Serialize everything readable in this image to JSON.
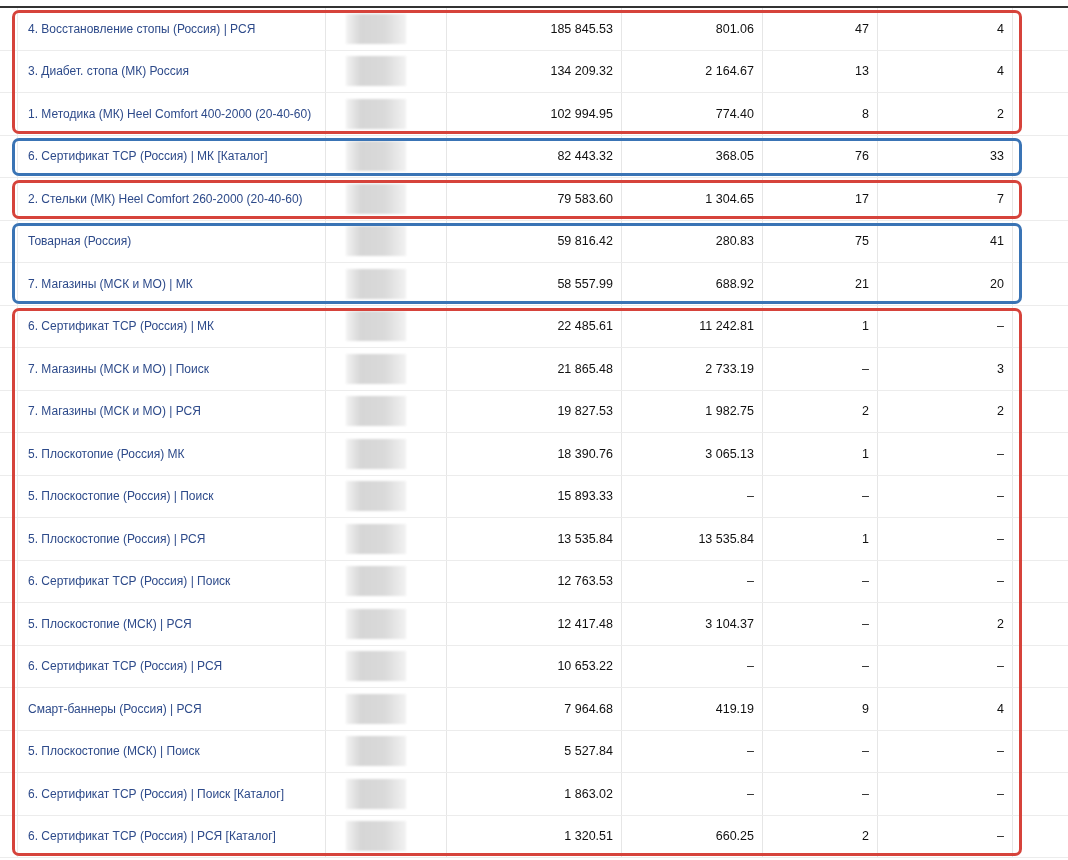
{
  "table": {
    "groups": [
      {
        "color": "#d6433b",
        "rows": [
          {
            "name": "4. Восстановление стопы (Россия) | РСЯ",
            "values": [
              "185 845.53",
              "801.06",
              "47",
              "4"
            ]
          },
          {
            "name": "3. Диабет. стопа (МК) Россия",
            "values": [
              "134 209.32",
              "2 164.67",
              "13",
              "4"
            ]
          },
          {
            "name": "1. Методика (МК) Heel Comfort 400-2000 (20-40-60)",
            "values": [
              "102 994.95",
              "774.40",
              "8",
              "2"
            ]
          }
        ]
      },
      {
        "color": "#3a74b5",
        "rows": [
          {
            "name": "6. Сертификат ТСР (Россия) | МК [Каталог]",
            "values": [
              "82 443.32",
              "368.05",
              "76",
              "33"
            ]
          }
        ]
      },
      {
        "color": "#d6433b",
        "rows": [
          {
            "name": "2. Стельки (МК) Heel Comfort 260-2000 (20-40-60)",
            "values": [
              "79 583.60",
              "1 304.65",
              "17",
              "7"
            ]
          }
        ]
      },
      {
        "color": "#3a74b5",
        "rows": [
          {
            "name": "Товарная (Россия)",
            "values": [
              "59 816.42",
              "280.83",
              "75",
              "41"
            ]
          },
          {
            "name": "7. Магазины (МСК и МО) | МК",
            "values": [
              "58 557.99",
              "688.92",
              "21",
              "20"
            ]
          }
        ]
      },
      {
        "color": "#d6433b",
        "rows": [
          {
            "name": "6. Сертификат ТСР (Россия) | МК",
            "values": [
              "22 485.61",
              "11 242.81",
              "1",
              "–"
            ]
          },
          {
            "name": "7. Магазины (МСК и МО) | Поиск",
            "values": [
              "21 865.48",
              "2 733.19",
              "–",
              "3"
            ]
          },
          {
            "name": "7. Магазины (МСК и МО) | РСЯ",
            "values": [
              "19 827.53",
              "1 982.75",
              "2",
              "2"
            ]
          },
          {
            "name": "5. Плоскотопие (Россия) МК",
            "values": [
              "18 390.76",
              "3 065.13",
              "1",
              "–"
            ]
          },
          {
            "name": "5. Плоскостопие (Россия) | Поиск",
            "values": [
              "15 893.33",
              "–",
              "–",
              "–"
            ]
          },
          {
            "name": "5. Плоскостопие (Россия) | РСЯ",
            "values": [
              "13 535.84",
              "13 535.84",
              "1",
              "–"
            ]
          },
          {
            "name": "6. Сертификат ТСР (Россия) | Поиск",
            "values": [
              "12 763.53",
              "–",
              "–",
              "–"
            ]
          },
          {
            "name": "5. Плоскостопие (МСК) | РСЯ",
            "values": [
              "12 417.48",
              "3 104.37",
              "–",
              "2"
            ]
          },
          {
            "name": "6. Сертификат ТСР (Россия) | РСЯ",
            "values": [
              "10 653.22",
              "–",
              "–",
              "–"
            ]
          },
          {
            "name": "Смарт-баннеры (Россия) | РСЯ",
            "values": [
              "7 964.68",
              "419.19",
              "9",
              "4"
            ]
          },
          {
            "name": "5. Плоскостопие (МСК) | Поиск",
            "values": [
              "5 527.84",
              "–",
              "–",
              "–"
            ]
          },
          {
            "name": "6. Сертификат ТСР (Россия) | Поиск [Каталог]",
            "values": [
              "1 863.02",
              "–",
              "–",
              "–"
            ]
          },
          {
            "name": "6. Сертификат ТСР (Россия) | РСЯ [Каталог]",
            "values": [
              "1 320.51",
              "660.25",
              "2",
              "–"
            ]
          }
        ]
      }
    ]
  }
}
